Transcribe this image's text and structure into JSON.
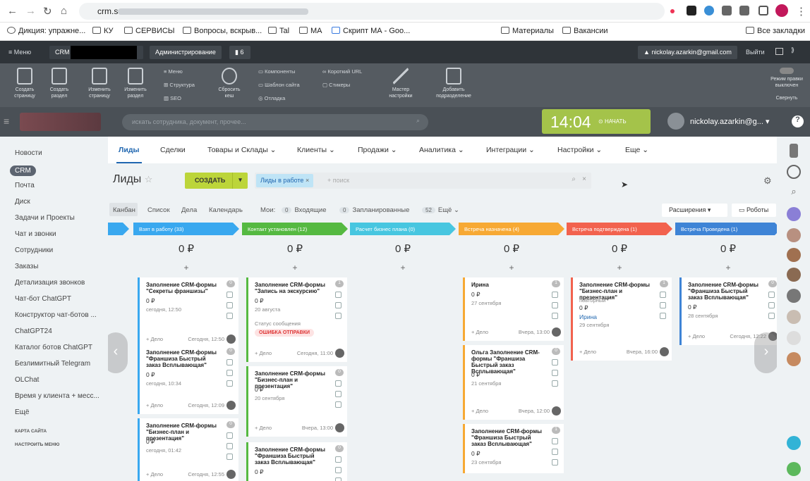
{
  "browser": {
    "url": "crm.s",
    "bookmarks": [
      "Дикция: упражне...",
      "КУ",
      "СЕРВИСЫ",
      "Вопросы, вскрыв...",
      "Tal",
      "МА",
      "Скрипт МА - Goo...",
      "Материалы",
      "Вакансии",
      "Все закладки"
    ]
  },
  "admin": {
    "menu": "Меню",
    "crm": "CRM",
    "administration": "Администрирование",
    "notif": "6",
    "email": "nickolay.azarkin@gmail.com",
    "logout": "Выйти"
  },
  "tools": [
    {
      "label": "Создать страницу"
    },
    {
      "label": "Создать раздел"
    },
    {
      "label": "Изменить страницу"
    },
    {
      "label": "Изменить раздел"
    }
  ],
  "tools_menu": [
    "Меню",
    "Структура",
    "SEO",
    "Компоненты",
    "Шаблон сайта",
    "Отладка",
    "Короткий URL",
    "Стикеры"
  ],
  "tools_right": [
    {
      "label": "Сбросить кеш"
    },
    {
      "label": "Мастер настройки"
    },
    {
      "label": "Добавить подразделение"
    }
  ],
  "tools_mode": {
    "label": "Режим правки",
    "state": "выключен",
    "collapse": "Свернуть"
  },
  "header": {
    "search_placeholder": "искать сотрудника, документ, прочее...",
    "time": "14:04",
    "start": "НАЧАТЬ",
    "user": "nickolay.azarkin@g..."
  },
  "left_menu": [
    "Новости",
    "CRM",
    "Почта",
    "Диск",
    "Задачи и Проекты",
    "Чат и звонки",
    "Сотрудники",
    "Заказы",
    "Детализация звонков",
    "Чат-бот ChatGPT",
    "Конструктор чат-ботов ...",
    "ChatGPT24",
    "Каталог ботов ChatGPT",
    "Безлимитный Telegram",
    "OLChat",
    "Время у клиента + месс...",
    "Ещё"
  ],
  "left_footer": [
    "КАРТА САЙТА",
    "НАСТРОИТЬ МЕНЮ"
  ],
  "tabs": [
    "Лиды",
    "Сделки",
    "Товары и Склады",
    "Клиенты",
    "Продажи",
    "Аналитика",
    "Интеграции",
    "Настройки",
    "Еще"
  ],
  "page": {
    "title": "Лиды",
    "create": "СОЗДАТЬ",
    "filter_chip": "Лиды в работе",
    "filter_placeholder": "+ поиск"
  },
  "views": [
    "Канбан",
    "Список",
    "Дела",
    "Календарь"
  ],
  "my": {
    "label": "Мои:",
    "incoming_count": "0",
    "incoming": "Входящие",
    "planned_count": "0",
    "planned": "Запланированные",
    "more_count": "52",
    "more": "Ещё"
  },
  "ext": "Расширения",
  "robots": "Роботы",
  "stages": [
    {
      "name": "",
      "sum": "",
      "color": "#39a8ef"
    },
    {
      "name": "Взят в работу (33)",
      "sum": "0 ₽",
      "color": "#39a8ef"
    },
    {
      "name": "Контакт установлен (12)",
      "sum": "0 ₽",
      "color": "#55b941"
    },
    {
      "name": "Расчет бизнес плана (0)",
      "sum": "0 ₽",
      "color": "#47c6e0"
    },
    {
      "name": "Встреча назначена (4)",
      "sum": "0 ₽",
      "color": "#f7a934"
    },
    {
      "name": "Встреча подтверждена (1)",
      "sum": "0 ₽",
      "color": "#f2624e"
    },
    {
      "name": "Встреча Проведена (1)",
      "sum": "0 ₽",
      "color": "#3e84d6"
    }
  ],
  "cards": [
    {
      "name": "Заполнение CRM-формы \"Секреты франшизы\"",
      "amount": "0 ₽",
      "date": "сегодня, 12:50",
      "deal": "+ Дело",
      "time": "Сегодня, 12:50",
      "count": "0"
    },
    {
      "name": "Заполнение CRM-формы \"Франшиза Быстрый заказ Всплывающая\"",
      "amount": "0 ₽",
      "date": "сегодня, 10:34",
      "deal": "+ Дело",
      "time": "Сегодня, 12:09",
      "count": "0"
    },
    {
      "name": "Заполнение CRM-формы \"Бизнес-план и презентация\"",
      "amount": "0 ₽",
      "date": "сегодня, 01:42",
      "deal": "+ Дело",
      "time": "Сегодня, 12:55",
      "count": "0"
    },
    {
      "name": "Заполнение CRM-формы \"Запись на экскурсию\"",
      "amount": "0 ₽",
      "date": "20 августа",
      "status_label": "Статус сообщения",
      "status": "ОШИБКА ОТПРАВКИ",
      "deal": "+ Дело",
      "time": "Сегодня, 11:00",
      "count": "1"
    },
    {
      "name": "Заполнение CRM-формы \"Бизнес-план и презентация\"",
      "amount": "0 ₽",
      "date": "20 сентября",
      "deal": "+ Дело",
      "time": "Вчера, 13:00",
      "count": "0"
    },
    {
      "name": "Заполнение CRM-формы \"Франшиза Быстрый заказ Всплывающая\"",
      "amount": "0 ₽",
      "count": "0"
    },
    {
      "name": "Ирина",
      "amount": "0 ₽",
      "date": "27 сентября",
      "deal": "+ Дело",
      "time": "Вчера, 13:00",
      "count": "1"
    },
    {
      "name": "Ольга Заполнение CRM-формы \"Франшиза Быстрый заказ Всплывающая\"",
      "amount": "0 ₽",
      "date": "21 сентября",
      "deal": "+ Дело",
      "time": "Вчера, 12:00",
      "count": "0"
    },
    {
      "name": "Заполнение CRM-формы \"Франшиза Быстрый заказ Всплывающая\"",
      "amount": "0 ₽",
      "date": "23 сентября",
      "count": "1"
    },
    {
      "name": "Заполнение CRM-формы \"Бизнес-план и презентация\"",
      "sub": "повторный",
      "amount": "0 ₽",
      "contact": "Ирина",
      "date": "29 сентября",
      "deal": "+ Дело",
      "time": "Вчера, 16:00",
      "count": "1"
    },
    {
      "name": "Заполнение CRM-формы \"Франшиза Быстрый заказ Всплывающая\"",
      "amount": "0 ₽",
      "date": "28 сентября",
      "deal": "+ Дело",
      "time": "Сегодня, 12:22",
      "count": "0"
    }
  ],
  "colors": {
    "accent": "#2067b0",
    "create": "#bcd53a",
    "clock": "#a4c34a"
  }
}
